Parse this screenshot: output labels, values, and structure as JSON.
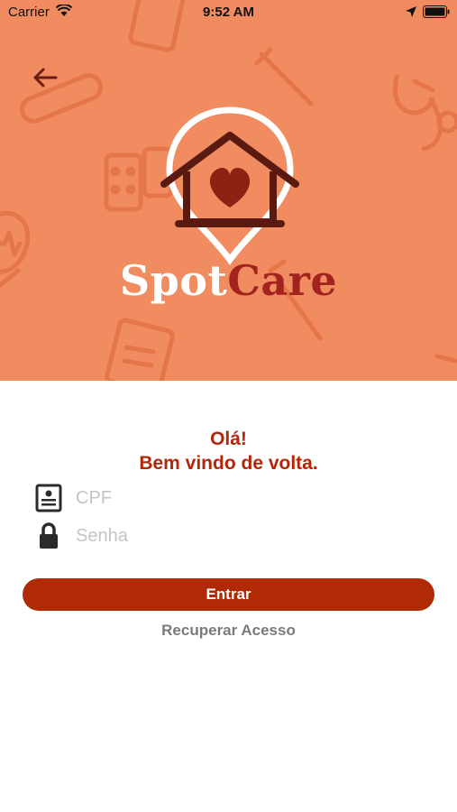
{
  "status_bar": {
    "carrier": "Carrier",
    "time": "9:52 AM",
    "icons": [
      "wifi-icon",
      "location-arrow-icon",
      "battery-icon"
    ]
  },
  "header": {
    "back_icon": "arrow-left-icon",
    "logo_icon": "house-heart-pin-icon",
    "brand_first": "Spot",
    "brand_second": "Care"
  },
  "login": {
    "greeting_line1": "Olá!",
    "greeting_line2": "Bem vindo de volta.",
    "cpf": {
      "icon": "id-card-icon",
      "placeholder": "CPF",
      "value": ""
    },
    "senha": {
      "icon": "lock-icon",
      "placeholder": "Senha",
      "value": ""
    },
    "submit_label": "Entrar",
    "recover_label": "Recuperar Acesso"
  },
  "colors": {
    "hero_background": "#f18c61",
    "brand_accent": "#a3241f",
    "greeting_text": "#b3260a",
    "button_background": "#b02a06",
    "link_text": "#7a7a7a"
  }
}
